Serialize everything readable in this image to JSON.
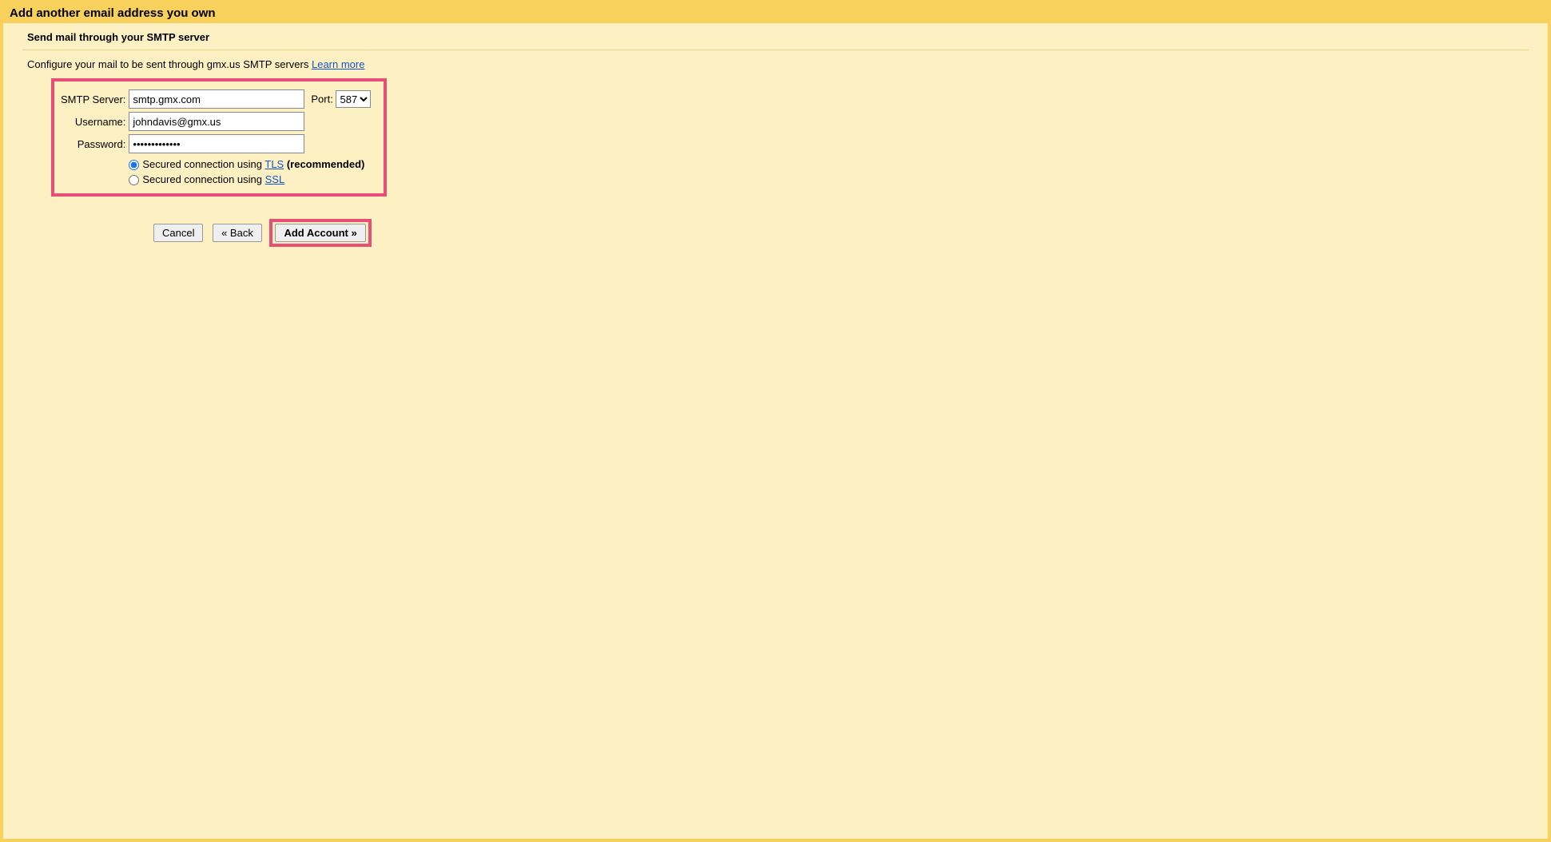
{
  "header": {
    "title": "Add another email address you own"
  },
  "subtitle": "Send mail through your SMTP server",
  "intro": {
    "text": "Configure your mail to be sent through gmx.us SMTP servers ",
    "learn_more": "Learn more"
  },
  "form": {
    "smtp_label": "SMTP Server:",
    "smtp_value": "smtp.gmx.com",
    "port_label": "Port:",
    "port_value": "587",
    "username_label": "Username:",
    "username_value": "johndavis@gmx.us",
    "password_label": "Password:",
    "password_value": "•••••••••••••",
    "tls_prefix": "Secured connection using ",
    "tls_link": "TLS",
    "tls_suffix": " (recommended)",
    "ssl_prefix": "Secured connection using ",
    "ssl_link": "SSL"
  },
  "buttons": {
    "cancel": "Cancel",
    "back": "« Back",
    "add_account": "Add Account »"
  }
}
